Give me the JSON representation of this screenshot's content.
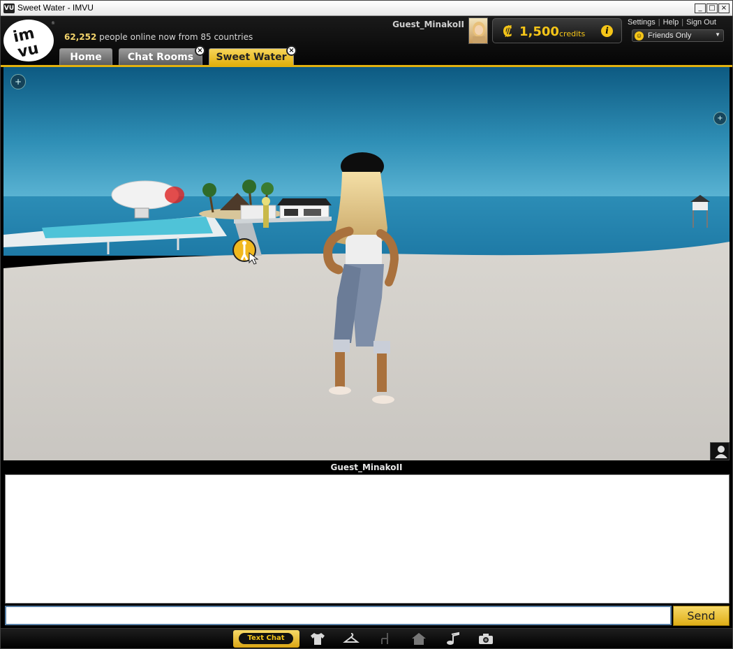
{
  "window": {
    "title": "Sweet Water - IMVU",
    "app_icon": "imvu-icon",
    "controls": [
      "minimize-icon",
      "maximize-icon",
      "close-icon"
    ]
  },
  "header": {
    "logo_text": "imvu",
    "online_count": "62,252",
    "online_suffix": "people online now from 85 countries",
    "username": "Guest_MinakoII",
    "credits": {
      "symbol": "₡",
      "amount": "1,500",
      "label": "credits"
    },
    "links": {
      "settings": "Settings",
      "help": "Help",
      "sign_out": "Sign Out"
    },
    "status": "Friends Only"
  },
  "tabs": [
    {
      "label": "Home",
      "active": false,
      "closable": false
    },
    {
      "label": "Chat Rooms",
      "active": false,
      "closable": true
    },
    {
      "label": "Sweet Water",
      "active": true,
      "closable": true
    }
  ],
  "scene": {
    "controls": [
      "plus-icon",
      "plus-icon"
    ],
    "walk_cursor": "walk-icon"
  },
  "chat": {
    "title": "Guest_MinakoII",
    "input_value": "",
    "send_label": "Send"
  },
  "toolbar": {
    "text_chat_label": "Text Chat",
    "icons": [
      "shirt-icon",
      "hanger-icon",
      "chair-icon",
      "home-icon",
      "music-icon",
      "camera-icon"
    ]
  },
  "colors": {
    "accent": "#e2b10f",
    "header_bg": "#111111",
    "credits": "#f5c518"
  }
}
